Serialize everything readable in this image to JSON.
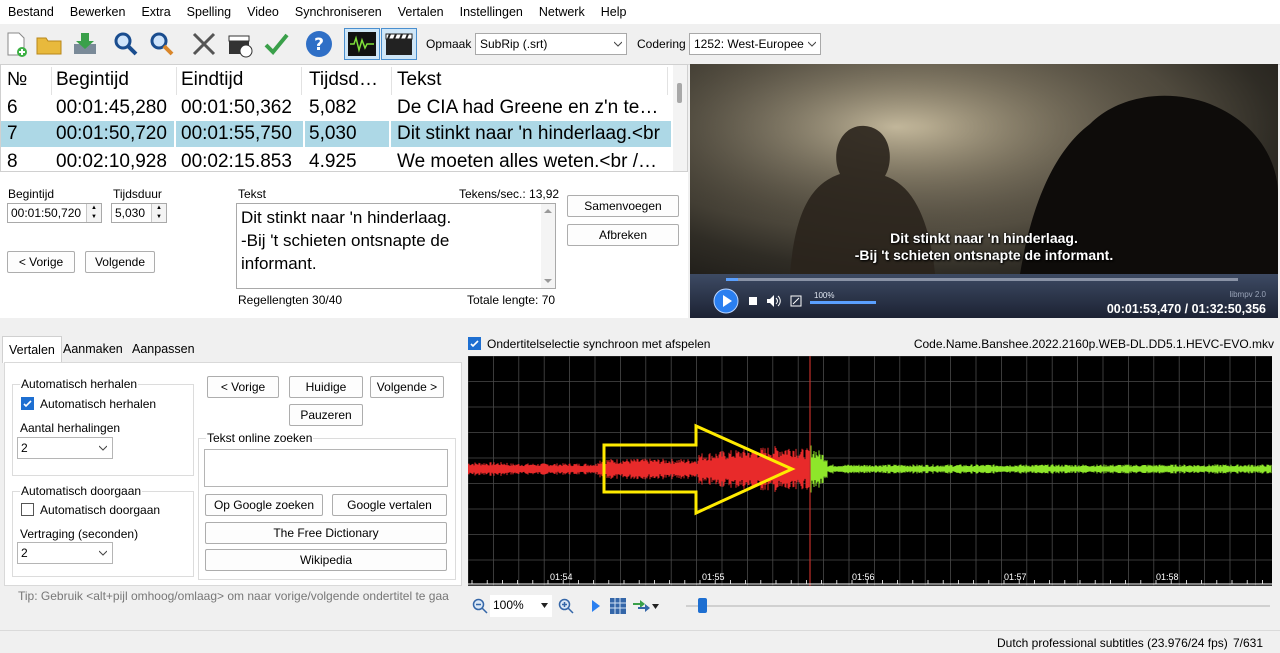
{
  "menu": [
    "Bestand",
    "Bewerken",
    "Extra",
    "Spelling",
    "Video",
    "Synchroniseren",
    "Vertalen",
    "Instellingen",
    "Netwerk",
    "Help"
  ],
  "toolbar": {
    "format_label": "Opmaak",
    "format_value": "SubRip (.srt)",
    "encoding_label": "Codering",
    "encoding_value": "1252: West-Europee"
  },
  "grid": {
    "headers": {
      "num": "№",
      "start": "Begintijd",
      "end": "Eindtijd",
      "duration": "Tijdsd…",
      "text": "Tekst"
    },
    "rows": [
      {
        "num": "6",
        "start": "00:01:45,280",
        "end": "00:01:50,362",
        "duration": "5,082",
        "text": "De CIA had Greene en z'n te…"
      },
      {
        "num": "7",
        "start": "00:01:50,720",
        "end": "00:01:55,750",
        "duration": "5,030",
        "text": "Dit stinkt naar 'n hinderlaag.<br"
      },
      {
        "num": "8",
        "start": "00:02:10,928",
        "end": "00:02:15.853",
        "duration": "4.925",
        "text": "We moeten alles weten.<br /…"
      }
    ]
  },
  "edit": {
    "start_label": "Begintijd",
    "start_value": "00:01:50,720",
    "duration_label": "Tijdsduur",
    "duration_value": "5,030",
    "text_label": "Tekst",
    "cps_label": "Tekens/sec.: 13,92",
    "line1": "Dit stinkt naar 'n hinderlaag.",
    "line2": "-Bij 't schieten ontsnapte de",
    "line3": "informant.",
    "line_lengths": "Regellengten 30/40",
    "total_length": "Totale lengte: 70",
    "merge_button": "Samenvoegen",
    "split_button": "Afbreken",
    "prev_button": "< Vorige",
    "next_button": "Volgende"
  },
  "video": {
    "sub_line1": "Dit stinkt naar 'n hinderlaag.",
    "sub_line2": "-Bij 't schieten ontsnapte de informant.",
    "volume_pct": "100%",
    "time": "00:01:53,470 / 01:32:50,356",
    "lib": "libmpv 2.0"
  },
  "tabs": [
    "Vertalen",
    "Aanmaken",
    "Aanpassen"
  ],
  "translate": {
    "auto_repeat_group": "Automatisch herhalen",
    "auto_repeat_check": "Automatisch herhalen",
    "repeat_count_label": "Aantal herhalingen",
    "repeat_count_value": "2",
    "auto_continue_group": "Automatisch doorgaan",
    "auto_continue_check": "Automatisch doorgaan",
    "delay_label": "Vertraging (seconden)",
    "delay_value": "2",
    "prev_button": "< Vorige",
    "current_button": "Huidige",
    "next_button": "Volgende >",
    "pause_button": "Pauzeren",
    "search_label": "Tekst online zoeken",
    "google_search": "Op Google zoeken",
    "google_translate": "Google vertalen",
    "free_dictionary": "The Free Dictionary",
    "wikipedia": "Wikipedia",
    "tip": "Tip: Gebruik <alt+pijl omhoog/omlaag> om naar vorige/volgende ondertitel te gaa"
  },
  "waveform": {
    "sync_check": "Ondertitelselectie synchroon met afspelen",
    "filename": "Code.Name.Banshee.2022.2160p.WEB-DL.DD5.1.HEVC-EVO.mkv",
    "time_labels": [
      "01:54",
      "01:55",
      "01:56",
      "01:57",
      "01:58"
    ],
    "zoom": "100%",
    "played_color": "#e82a2a",
    "unplayed_color": "#8ee62a",
    "arrow_color": "#ffeb00"
  },
  "status": {
    "profile": "Dutch professional subtitles (23.976/24 fps)",
    "position": "7/631"
  }
}
